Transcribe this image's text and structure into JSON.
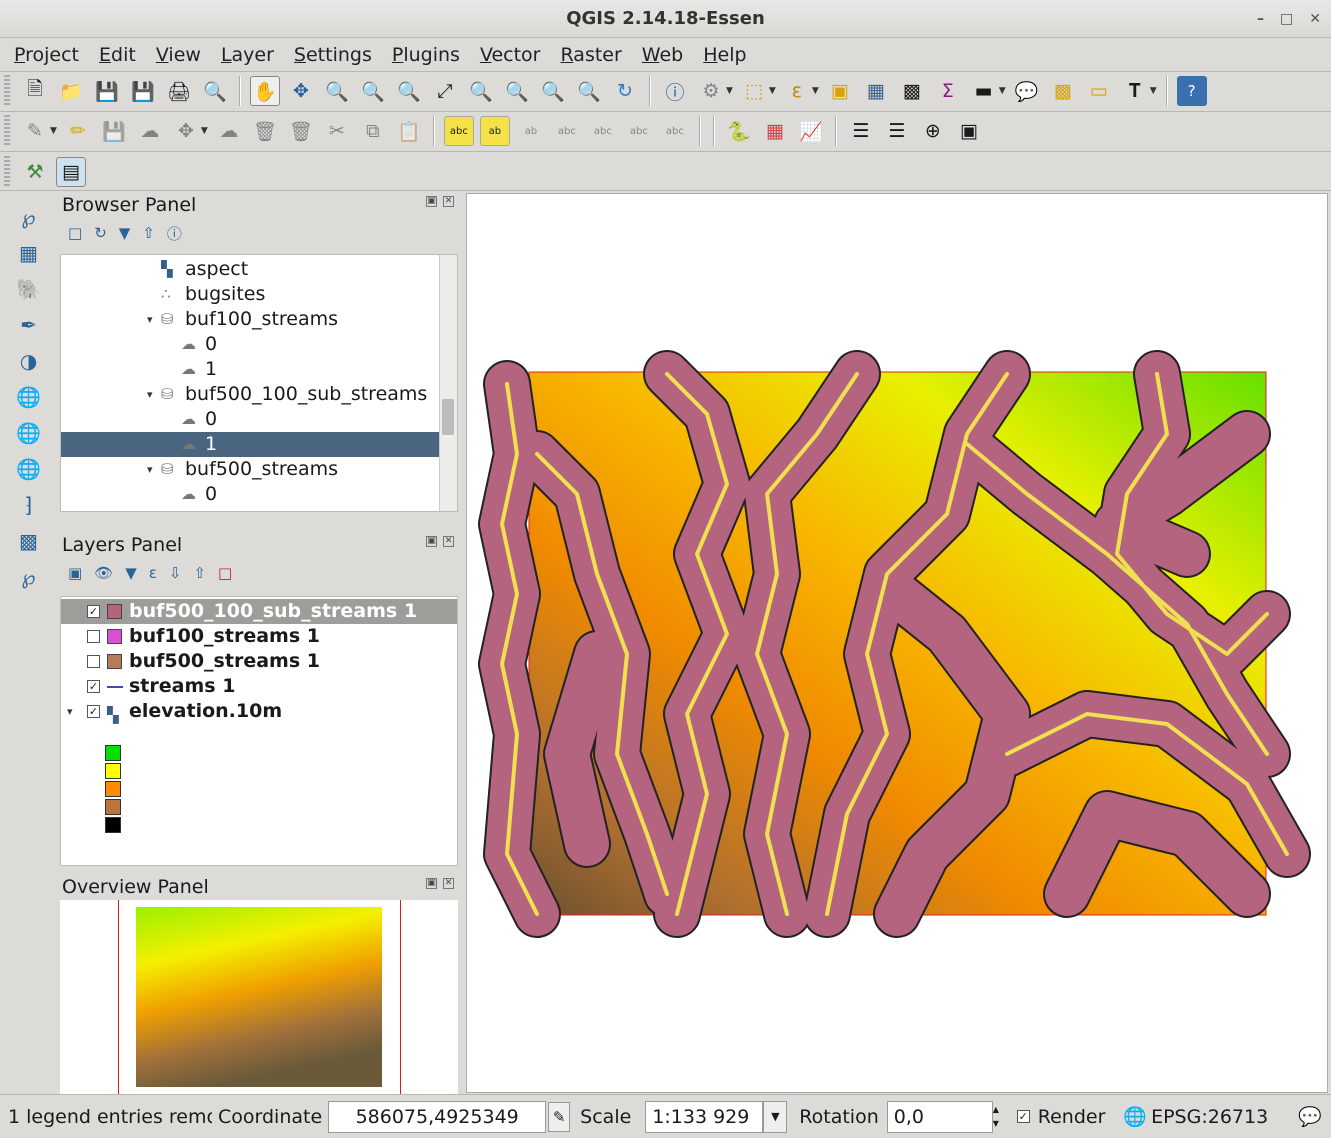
{
  "window": {
    "title": "QGIS 2.14.18-Essen"
  },
  "menu": [
    "Project",
    "Edit",
    "View",
    "Layer",
    "Settings",
    "Plugins",
    "Vector",
    "Raster",
    "Web",
    "Help"
  ],
  "browser": {
    "title": "Browser Panel",
    "items": [
      {
        "label": "aspect",
        "type": "raster",
        "indent": 1
      },
      {
        "label": "bugsites",
        "type": "points",
        "indent": 1
      },
      {
        "label": "buf100_streams",
        "type": "db",
        "indent": 1,
        "expanded": true
      },
      {
        "label": "0",
        "type": "polygon",
        "indent": 2
      },
      {
        "label": "1",
        "type": "polygon",
        "indent": 2
      },
      {
        "label": "buf500_100_sub_streams",
        "type": "db",
        "indent": 1,
        "expanded": true
      },
      {
        "label": "0",
        "type": "polygon",
        "indent": 2
      },
      {
        "label": "1",
        "type": "polygon",
        "indent": 2,
        "selected": true
      },
      {
        "label": "buf500_streams",
        "type": "db",
        "indent": 1,
        "expanded": true
      },
      {
        "label": "0",
        "type": "polygon",
        "indent": 2
      }
    ]
  },
  "layers": {
    "title": "Layers Panel",
    "items": [
      {
        "label": "buf500_100_sub_streams 1",
        "checked": true,
        "color": "#b5647f",
        "selected": true
      },
      {
        "label": "buf100_streams 1",
        "checked": false,
        "color": "#d94fd8"
      },
      {
        "label": "buf500_streams 1",
        "checked": false,
        "color": "#b57c5c"
      },
      {
        "label": "streams 1",
        "checked": true,
        "color": "#3b4db0",
        "line": true
      },
      {
        "label": "elevation.10m",
        "checked": true,
        "raster": true,
        "expanded": true
      }
    ],
    "legend_colors": [
      "#00e000",
      "#ffff00",
      "#ff8c00",
      "#b8763c",
      "#000000"
    ]
  },
  "overview": {
    "title": "Overview Panel"
  },
  "status": {
    "message": "1 legend entries remo",
    "coordinate_label": "Coordinate",
    "coordinate_value": "586075,4925349",
    "scale_label": "Scale",
    "scale_value": "1:133 929",
    "rotation_label": "Rotation",
    "rotation_value": "0,0",
    "render_label": "Render",
    "render_checked": true,
    "crs": "EPSG:26713"
  }
}
